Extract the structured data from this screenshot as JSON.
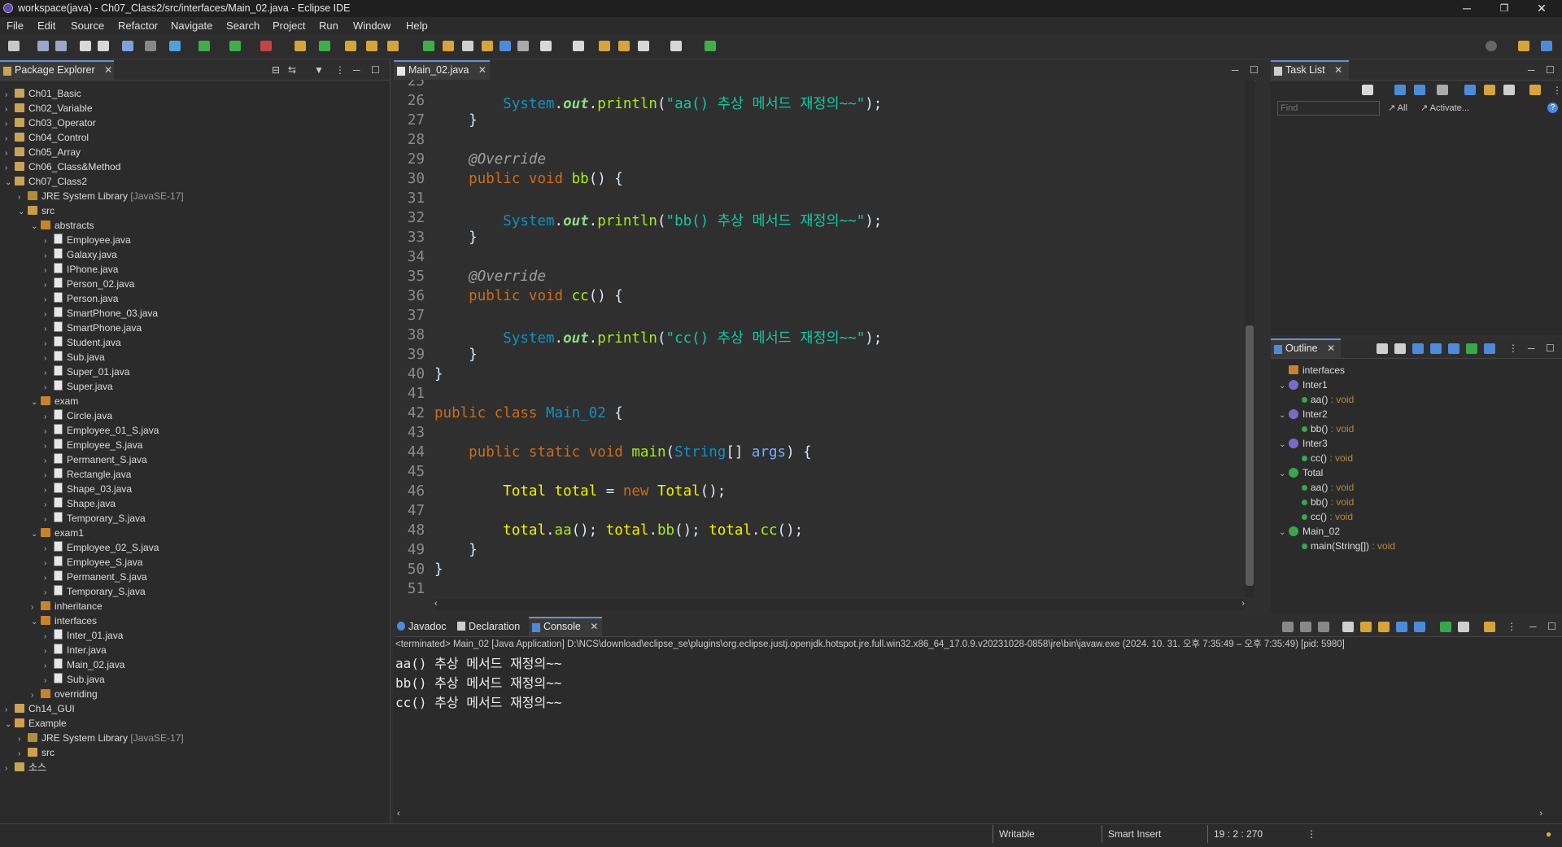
{
  "window": {
    "title": "workspace(java) - Ch07_Class2/src/interfaces/Main_02.java - Eclipse IDE",
    "minimize": "─",
    "restore": "❐",
    "close": "✕"
  },
  "menu": [
    "File",
    "Edit",
    "Source",
    "Refactor",
    "Navigate",
    "Search",
    "Project",
    "Run",
    "Window",
    "Help"
  ],
  "package_explorer": {
    "title": "Package Explorer",
    "rows": [
      {
        "label": "Ch01_Basic",
        "depth": 0,
        "arrow": "›",
        "icon": "proj"
      },
      {
        "label": "Ch02_Variable",
        "depth": 0,
        "arrow": "›",
        "icon": "proj"
      },
      {
        "label": "Ch03_Operator",
        "depth": 0,
        "arrow": "›",
        "icon": "proj"
      },
      {
        "label": "Ch04_Control",
        "depth": 0,
        "arrow": "›",
        "icon": "proj"
      },
      {
        "label": "Ch05_Array",
        "depth": 0,
        "arrow": "›",
        "icon": "proj"
      },
      {
        "label": "Ch06_Class&Method",
        "depth": 0,
        "arrow": "›",
        "icon": "proj"
      },
      {
        "label": "Ch07_Class2",
        "depth": 0,
        "arrow": "⌄",
        "icon": "proj"
      },
      {
        "label": "JRE System Library",
        "suffix": " [JavaSE-17]",
        "depth": 1,
        "arrow": "›",
        "icon": "lib"
      },
      {
        "label": "src",
        "depth": 1,
        "arrow": "⌄",
        "icon": "src"
      },
      {
        "label": "abstracts",
        "depth": 2,
        "arrow": "⌄",
        "icon": "pkg"
      },
      {
        "label": "Employee.java",
        "depth": 3,
        "arrow": "›",
        "icon": "java"
      },
      {
        "label": "Galaxy.java",
        "depth": 3,
        "arrow": "›",
        "icon": "java"
      },
      {
        "label": "IPhone.java",
        "depth": 3,
        "arrow": "›",
        "icon": "java"
      },
      {
        "label": "Person_02.java",
        "depth": 3,
        "arrow": "›",
        "icon": "java"
      },
      {
        "label": "Person.java",
        "depth": 3,
        "arrow": "›",
        "icon": "java"
      },
      {
        "label": "SmartPhone_03.java",
        "depth": 3,
        "arrow": "›",
        "icon": "java"
      },
      {
        "label": "SmartPhone.java",
        "depth": 3,
        "arrow": "›",
        "icon": "java"
      },
      {
        "label": "Student.java",
        "depth": 3,
        "arrow": "›",
        "icon": "java"
      },
      {
        "label": "Sub.java",
        "depth": 3,
        "arrow": "›",
        "icon": "java"
      },
      {
        "label": "Super_01.java",
        "depth": 3,
        "arrow": "›",
        "icon": "java"
      },
      {
        "label": "Super.java",
        "depth": 3,
        "arrow": "›",
        "icon": "java"
      },
      {
        "label": "exam",
        "depth": 2,
        "arrow": "⌄",
        "icon": "pkg"
      },
      {
        "label": "Circle.java",
        "depth": 3,
        "arrow": "›",
        "icon": "java"
      },
      {
        "label": "Employee_01_S.java",
        "depth": 3,
        "arrow": "›",
        "icon": "java"
      },
      {
        "label": "Employee_S.java",
        "depth": 3,
        "arrow": "›",
        "icon": "java"
      },
      {
        "label": "Permanent_S.java",
        "depth": 3,
        "arrow": "›",
        "icon": "java"
      },
      {
        "label": "Rectangle.java",
        "depth": 3,
        "arrow": "›",
        "icon": "java"
      },
      {
        "label": "Shape_03.java",
        "depth": 3,
        "arrow": "›",
        "icon": "java"
      },
      {
        "label": "Shape.java",
        "depth": 3,
        "arrow": "›",
        "icon": "java"
      },
      {
        "label": "Temporary_S.java",
        "depth": 3,
        "arrow": "›",
        "icon": "java"
      },
      {
        "label": "exam1",
        "depth": 2,
        "arrow": "⌄",
        "icon": "pkg"
      },
      {
        "label": "Employee_02_S.java",
        "depth": 3,
        "arrow": "›",
        "icon": "java"
      },
      {
        "label": "Employee_S.java",
        "depth": 3,
        "arrow": "›",
        "icon": "java"
      },
      {
        "label": "Permanent_S.java",
        "depth": 3,
        "arrow": "›",
        "icon": "java"
      },
      {
        "label": "Temporary_S.java",
        "depth": 3,
        "arrow": "›",
        "icon": "java"
      },
      {
        "label": "inheritance",
        "depth": 2,
        "arrow": "›",
        "icon": "pkg"
      },
      {
        "label": "interfaces",
        "depth": 2,
        "arrow": "⌄",
        "icon": "pkg"
      },
      {
        "label": "Inter_01.java",
        "depth": 3,
        "arrow": "›",
        "icon": "java"
      },
      {
        "label": "Inter.java",
        "depth": 3,
        "arrow": "›",
        "icon": "java"
      },
      {
        "label": "Main_02.java",
        "depth": 3,
        "arrow": "›",
        "icon": "java"
      },
      {
        "label": "Sub.java",
        "depth": 3,
        "arrow": "›",
        "icon": "java"
      },
      {
        "label": "overriding",
        "depth": 2,
        "arrow": "›",
        "icon": "pkg"
      },
      {
        "label": "Ch14_GUI",
        "depth": 0,
        "arrow": "›",
        "icon": "proj"
      },
      {
        "label": "Example",
        "depth": 0,
        "arrow": "⌄",
        "icon": "err"
      },
      {
        "label": "JRE System Library",
        "suffix": " [JavaSE-17]",
        "depth": 1,
        "arrow": "›",
        "icon": "lib"
      },
      {
        "label": "src",
        "depth": 1,
        "arrow": "›",
        "icon": "err"
      },
      {
        "label": "소스",
        "depth": 0,
        "arrow": "›",
        "icon": "proj"
      }
    ]
  },
  "editor": {
    "tab": "Main_02.java",
    "first_line": 25,
    "lines": [
      {
        "n": "25",
        "html": ""
      },
      {
        "n": "26",
        "html": "        <span class='cls'>System</span>.<span class='fld'>out</span>.<span class='fn'>println</span>(<span class='str'>\"aa() 추상 메서드 재정의~~\"</span>);"
      },
      {
        "n": "27",
        "html": "    }"
      },
      {
        "n": "28",
        "html": ""
      },
      {
        "n": "29",
        "html": "    <span class='ann'>@Override</span>"
      },
      {
        "n": "30",
        "html": "    <span class='kw'>public</span> <span class='kw'>void</span> <span class='fn'>bb</span>() {"
      },
      {
        "n": "31",
        "html": ""
      },
      {
        "n": "32",
        "html": "        <span class='cls'>System</span>.<span class='fld'>out</span>.<span class='fn'>println</span>(<span class='str'>\"bb() 추상 메서드 재정의~~\"</span>);"
      },
      {
        "n": "33",
        "html": "    }"
      },
      {
        "n": "34",
        "html": ""
      },
      {
        "n": "35",
        "html": "    <span class='ann'>@Override</span>"
      },
      {
        "n": "36",
        "html": "    <span class='kw'>public</span> <span class='kw'>void</span> <span class='fn'>cc</span>() {"
      },
      {
        "n": "37",
        "html": ""
      },
      {
        "n": "38",
        "html": "        <span class='cls'>System</span>.<span class='fld'>out</span>.<span class='fn'>println</span>(<span class='str'>\"cc() 추상 메서드 재정의~~\"</span>);"
      },
      {
        "n": "39",
        "html": "    }"
      },
      {
        "n": "40",
        "html": "}"
      },
      {
        "n": "41",
        "html": ""
      },
      {
        "n": "42",
        "html": "<span class='kw'>public</span> <span class='kw'>class</span> <span class='cls'>Main_02</span> {"
      },
      {
        "n": "43",
        "html": ""
      },
      {
        "n": "44",
        "html": "    <span class='kw'>public</span> <span class='kw'>static</span> <span class='kw'>void</span> <span class='fn'>main</span>(<span class='cls'>String</span>[] <span class='par'>args</span>) {"
      },
      {
        "n": "45",
        "html": ""
      },
      {
        "n": "46",
        "html": "        <span class='var'>Total</span> <span class='var'>total</span> = <span class='kw'>new</span> <span class='var'>Total</span>();"
      },
      {
        "n": "47",
        "html": ""
      },
      {
        "n": "48",
        "html": "        <span class='var'>total</span>.<span class='fn'>aa</span>(); <span class='var'>total</span>.<span class='fn'>bb</span>(); <span class='var'>total</span>.<span class='fn'>cc</span>();"
      },
      {
        "n": "49",
        "html": "    }"
      },
      {
        "n": "50",
        "html": "}"
      },
      {
        "n": "51",
        "html": ""
      }
    ]
  },
  "task_list": {
    "title": "Task List",
    "find_placeholder": "Find",
    "all_label": "All",
    "activate_label": "Activate..."
  },
  "outline": {
    "title": "Outline",
    "rows": [
      {
        "label": "interfaces",
        "ret": "",
        "depth": 0,
        "kind": "pkg"
      },
      {
        "label": "Inter1",
        "ret": "",
        "depth": 0,
        "kind": "iface"
      },
      {
        "label": "aa()",
        "ret": " : void",
        "depth": 1,
        "kind": "method"
      },
      {
        "label": "Inter2",
        "ret": "",
        "depth": 0,
        "kind": "iface"
      },
      {
        "label": "bb()",
        "ret": " : void",
        "depth": 1,
        "kind": "method"
      },
      {
        "label": "Inter3",
        "ret": "",
        "depth": 0,
        "kind": "iface"
      },
      {
        "label": "cc()",
        "ret": " : void",
        "depth": 1,
        "kind": "method"
      },
      {
        "label": "Total",
        "ret": "",
        "depth": 0,
        "kind": "class"
      },
      {
        "label": "aa()",
        "ret": " : void",
        "depth": 1,
        "kind": "method"
      },
      {
        "label": "bb()",
        "ret": " : void",
        "depth": 1,
        "kind": "method"
      },
      {
        "label": "cc()",
        "ret": " : void",
        "depth": 1,
        "kind": "method"
      },
      {
        "label": "Main_02",
        "ret": "",
        "depth": 0,
        "kind": "class"
      },
      {
        "label": "main(String[])",
        "ret": " : void",
        "depth": 1,
        "kind": "method"
      }
    ]
  },
  "bottom_tabs": {
    "javadoc": "Javadoc",
    "declaration": "Declaration",
    "console": "Console"
  },
  "console": {
    "terminated": "<terminated> Main_02 [Java Application] D:\\NCS\\download\\eclipse_se\\plugins\\org.eclipse.justj.openjdk.hotspot.jre.full.win32.x86_64_17.0.9.v20231028-0858\\jre\\bin\\javaw.exe  (2024. 10. 31. 오후 7:35:49 – 오후 7:35:49) [pid: 5980]",
    "lines": [
      "aa() 추상 메서드 재정의~~",
      "bb() 추상 메서드 재정의~~",
      "cc() 추상 메서드 재정의~~"
    ]
  },
  "status": {
    "writable": "Writable",
    "insert": "Smart Insert",
    "position": "19 : 2 : 270"
  }
}
